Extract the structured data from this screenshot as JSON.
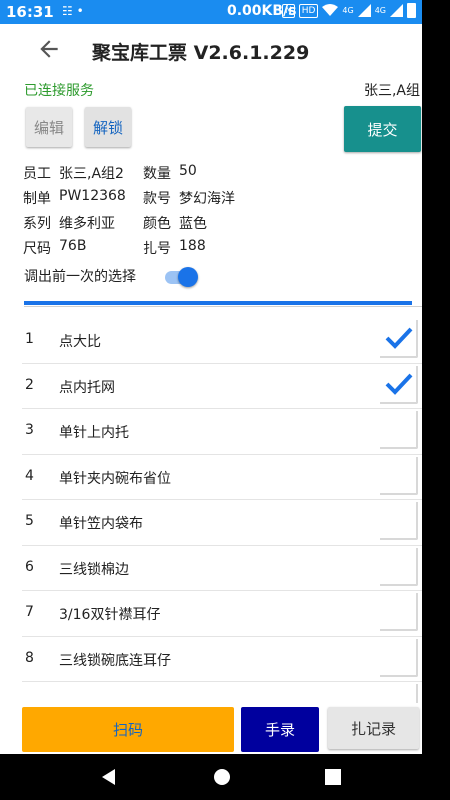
{
  "status_bar": {
    "time": "16:31",
    "notifications": "☷ •",
    "speed": "0.00KB/s",
    "nfc": "N",
    "hd": "HD",
    "net1": "4G",
    "net2": "4G"
  },
  "header": {
    "title": "聚宝库工票 V2.6.1.229",
    "back_icon": "arrow-left-icon"
  },
  "connection_status": "已连接服务",
  "user_group": "张三,A组",
  "buttons": {
    "edit": "编辑",
    "unlock": "解锁",
    "submit": "提交",
    "scan": "扫码",
    "manual": "手录",
    "record": "扎记录"
  },
  "info": {
    "rows": [
      [
        {
          "key": "员工",
          "value": "张三,A组2"
        },
        {
          "key": "数量",
          "value": "50"
        }
      ],
      [
        {
          "key": "制单",
          "value": "PW12368"
        },
        {
          "key": "款号",
          "value": "梦幻海洋"
        }
      ],
      [
        {
          "key": "系列",
          "value": "维多利亚"
        },
        {
          "key": "颜色",
          "value": "蓝色"
        }
      ],
      [
        {
          "key": "尺码",
          "value": "76B"
        },
        {
          "key": "扎号",
          "value": "188"
        }
      ]
    ]
  },
  "recall_label": "调出前一次的选择",
  "recall_enabled": true,
  "process_items": [
    {
      "num": "1",
      "name": "点大比",
      "checked": true
    },
    {
      "num": "2",
      "name": "点内托网",
      "checked": true
    },
    {
      "num": "3",
      "name": "单针上内托",
      "checked": false
    },
    {
      "num": "4",
      "name": "单针夹内碗布省位",
      "checked": false
    },
    {
      "num": "5",
      "name": "单针笠内袋布",
      "checked": false
    },
    {
      "num": "6",
      "name": "三线锁棉边",
      "checked": false
    },
    {
      "num": "7",
      "name": "3/16双针襟耳仔",
      "checked": false
    },
    {
      "num": "8",
      "name": "三线锁碗底连耳仔",
      "checked": false
    },
    {
      "num": "",
      "name": "",
      "checked": false
    }
  ],
  "colors": {
    "status_bar": "#1a8cf0",
    "submit": "#17908d",
    "scan": "#ffa800",
    "manual": "#00009e",
    "accent": "#1a73e8",
    "connected": "#2e9b2e"
  }
}
